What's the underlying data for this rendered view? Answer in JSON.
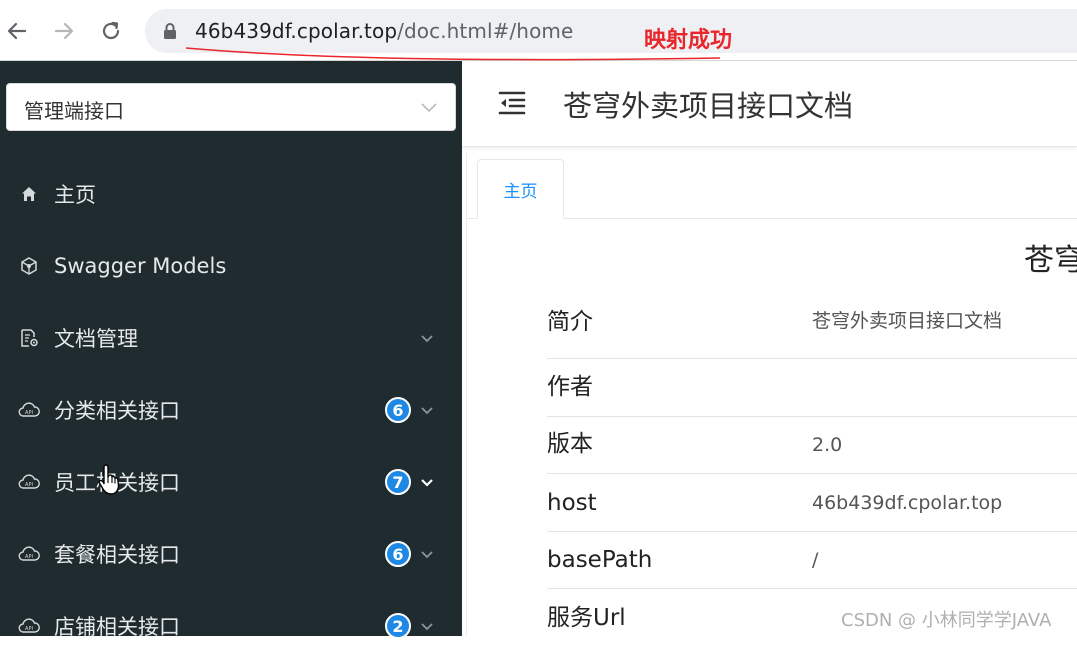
{
  "browser": {
    "url_host": "46b439df.cpolar.top",
    "url_path": "/doc.html#/home",
    "annotation": "映射成功"
  },
  "sidebar": {
    "group_select": "管理端接口",
    "items": [
      {
        "label": "主页",
        "icon": "home-icon",
        "badge": null,
        "chevron": false
      },
      {
        "label": "Swagger Models",
        "icon": "cube-icon",
        "badge": null,
        "chevron": false
      },
      {
        "label": "文档管理",
        "icon": "doc-settings-icon",
        "badge": null,
        "chevron": "down"
      },
      {
        "label": "分类相关接口",
        "icon": "api-cloud-icon",
        "badge": "6",
        "chevron": "down"
      },
      {
        "label": "员工相关接口",
        "icon": "api-cloud-icon",
        "badge": "7",
        "chevron": "down-active"
      },
      {
        "label": "套餐相关接口",
        "icon": "api-cloud-icon",
        "badge": "6",
        "chevron": "down"
      },
      {
        "label": "店铺相关接口",
        "icon": "api-cloud-icon",
        "badge": "2",
        "chevron": "down"
      }
    ]
  },
  "header": {
    "title": "苍穹外卖项目接口文档"
  },
  "tabs": [
    {
      "label": "主页",
      "active": true
    }
  ],
  "home": {
    "heading": "苍穹",
    "rows": [
      {
        "key": "简介",
        "value": "苍穹外卖项目接口文档"
      },
      {
        "key": "作者",
        "value": ""
      },
      {
        "key": "版本",
        "value": "2.0"
      },
      {
        "key": "host",
        "value": "46b439df.cpolar.top"
      },
      {
        "key": "basePath",
        "value": "/"
      },
      {
        "key": "服务Url",
        "value": ""
      }
    ]
  },
  "watermark": "CSDN @ 小林同学学JAVA",
  "colors": {
    "sidebar_bg": "#1f2b2e",
    "badge": "#1e88e5",
    "tab_active": "#1890ff",
    "annotation": "#e8262b"
  }
}
